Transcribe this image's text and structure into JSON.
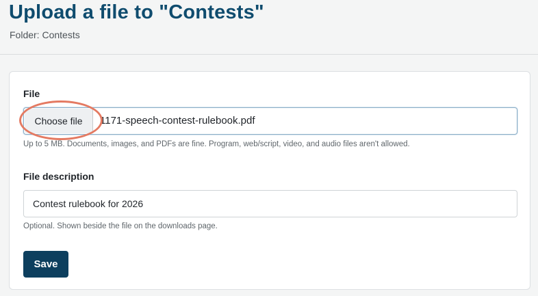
{
  "header": {
    "title": "Upload a file to \"Contests\"",
    "folder": "Folder: Contests"
  },
  "form": {
    "file": {
      "label": "File",
      "button_label": "Choose file",
      "selected_file": "1171-speech-contest-rulebook.pdf",
      "hint": "Up to 5 MB. Documents, images, and PDFs are fine. Program, web/script, video, and audio files aren't allowed."
    },
    "description": {
      "label": "File description",
      "value": "Contest rulebook for 2026",
      "hint": "Optional. Shown beside the file on the downloads page."
    },
    "save_label": "Save"
  },
  "colors": {
    "title": "#0f4c6e",
    "primary_button": "#0d3f5e",
    "highlight_ring": "#e47a62"
  }
}
